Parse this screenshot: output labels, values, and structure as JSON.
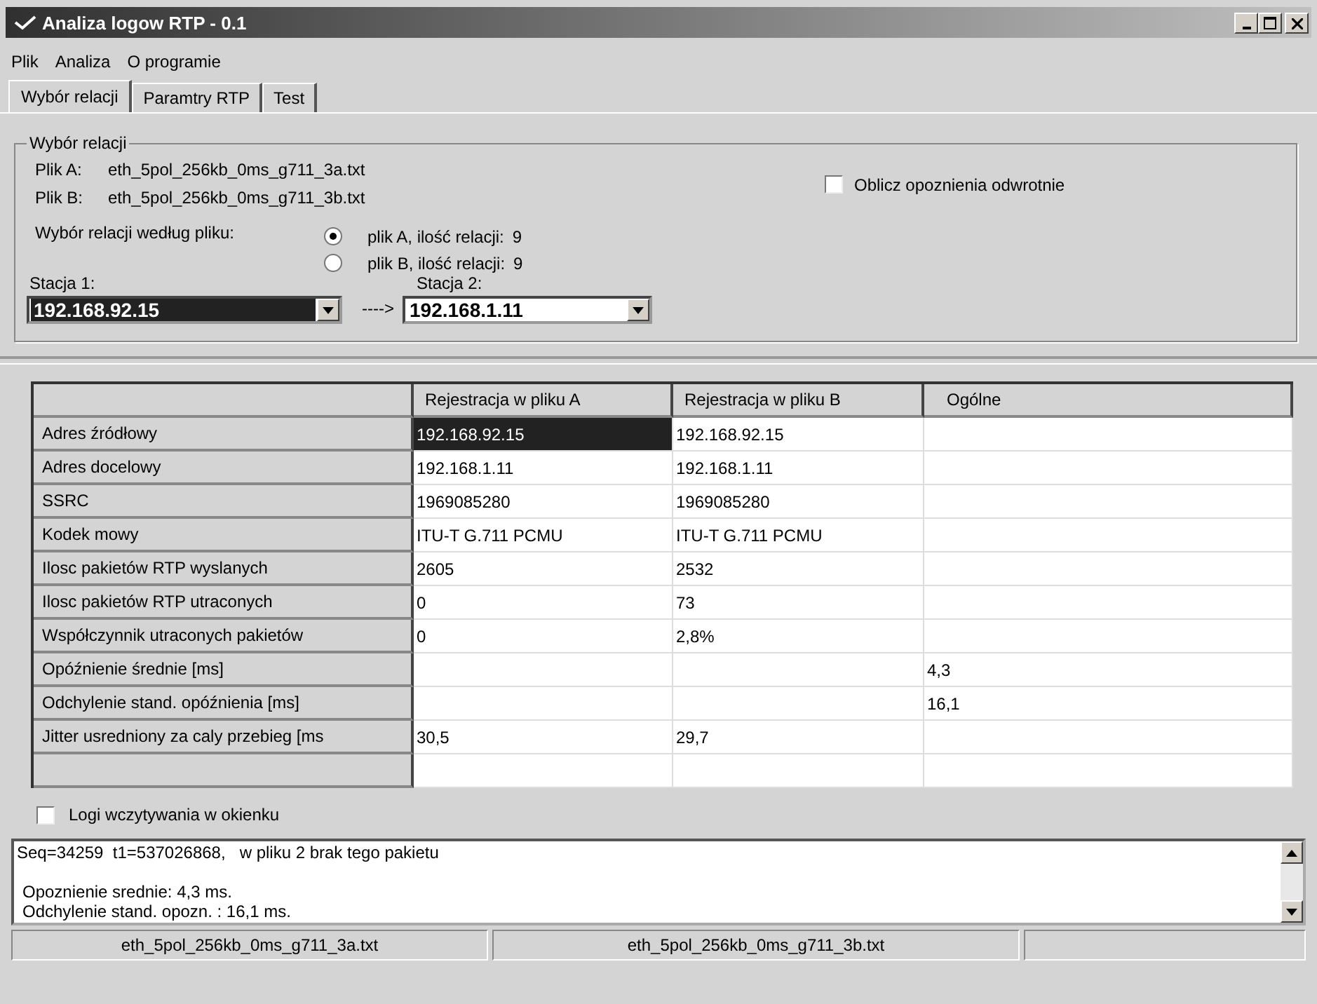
{
  "window": {
    "title": "Analiza logow RTP - 0.1"
  },
  "menu": [
    "Plik",
    "Analiza",
    "O programie"
  ],
  "tabs": [
    {
      "label": "Wybór relacji",
      "selected": true
    },
    {
      "label": "Paramtry RTP",
      "selected": false
    },
    {
      "label": "Test",
      "selected": false
    }
  ],
  "group": {
    "title": "Wybór relacji",
    "files": [
      {
        "label": "Plik A:",
        "value": "eth_5pol_256kb_0ms_g711_3a.txt"
      },
      {
        "label": "Plik B:",
        "value": "eth_5pol_256kb_0ms_g711_3b.txt"
      }
    ],
    "reverse_checkbox": {
      "label": "Oblicz opoznienia odwrotnie",
      "checked": false
    },
    "choice_label": "Wybór relacji według pliku:",
    "choices": [
      {
        "label": "plik A, ilość relacji:",
        "count": "9",
        "selected": true
      },
      {
        "label": "plik B, ilość relacji:",
        "count": "9",
        "selected": false
      }
    ],
    "stations": [
      {
        "label": "Stacja 1:",
        "value": "192.168.92.15",
        "highlighted": true
      },
      {
        "label": "Stacja 2:",
        "value": "192.168.1.11",
        "highlighted": false
      }
    ],
    "arrow": "---->"
  },
  "table": {
    "columns": [
      "Rejestracja w pliku A",
      "Rejestracja w pliku B",
      "Ogólne"
    ],
    "rows": [
      {
        "label": "Adres źródłowy",
        "cells": [
          {
            "text": "192.168.92.15",
            "selected": true
          },
          {
            "text": "192.168.92.15",
            "selected": false
          },
          {
            "selected": false
          }
        ]
      },
      {
        "label": "Adres docelowy",
        "cells": [
          {
            "text": "192.168.1.11",
            "selected": false
          },
          {
            "text": "192.168.1.11",
            "selected": false
          },
          {
            "selected": false
          }
        ]
      },
      {
        "label": "SSRC",
        "cells": [
          {
            "text": "1969085280",
            "selected": false
          },
          {
            "text": "1969085280",
            "selected": false
          },
          {
            "selected": false
          }
        ]
      },
      {
        "label": "Kodek mowy",
        "cells": [
          {
            "text": "ITU-T G.711 PCMU",
            "selected": false
          },
          {
            "text": "ITU-T G.711 PCMU",
            "selected": false
          },
          {
            "selected": false
          }
        ]
      },
      {
        "label": "Ilosc pakietów RTP wyslanych",
        "cells": [
          {
            "text": "2605",
            "selected": false
          },
          {
            "text": "2532",
            "selected": false
          },
          {
            "selected": false
          }
        ]
      },
      {
        "label": "Ilosc pakietów RTP utraconych",
        "cells": [
          {
            "text": "0",
            "selected": false
          },
          {
            "text": "73",
            "selected": false
          },
          {
            "selected": false
          }
        ]
      },
      {
        "label": "Współczynnik utraconych pakietów",
        "cells": [
          {
            "text": "0",
            "selected": false
          },
          {
            "text": "2,8%",
            "selected": false
          },
          {
            "selected": false
          }
        ]
      },
      {
        "label": "Opóźnienie średnie [ms]",
        "cells": [
          {
            "selected": false
          },
          {
            "selected": false
          },
          {
            "text": "4,3",
            "selected": false
          }
        ]
      },
      {
        "label": "Odchylenie stand. opóźnienia [ms]",
        "cells": [
          {
            "selected": false
          },
          {
            "selected": false
          },
          {
            "text": "16,1",
            "selected": false
          }
        ]
      },
      {
        "label": "Jitter usredniony za caly przebieg [ms",
        "cells": [
          {
            "text": "30,5",
            "selected": false
          },
          {
            "text": "29,7",
            "selected": false
          },
          {
            "selected": false
          }
        ]
      },
      {
        "cells": [
          {
            "selected": false
          },
          {
            "selected": false
          },
          {
            "selected": false
          }
        ]
      }
    ]
  },
  "log_checkbox": {
    "label": "Logi wczytywania w okienku",
    "checked": false
  },
  "log": [
    [
      "Seq=34259  t1=537026868,   w pliku 2 brak tego pakietu"
    ],
    [
      "Opoznienie srednie: 4,3 ms.",
      "Odchylenie stand. opozn. : 16,1 ms."
    ]
  ],
  "status_bar": [
    "eth_5pol_256kb_0ms_g711_3a.txt",
    "eth_5pol_256kb_0ms_g711_3b.txt"
  ]
}
